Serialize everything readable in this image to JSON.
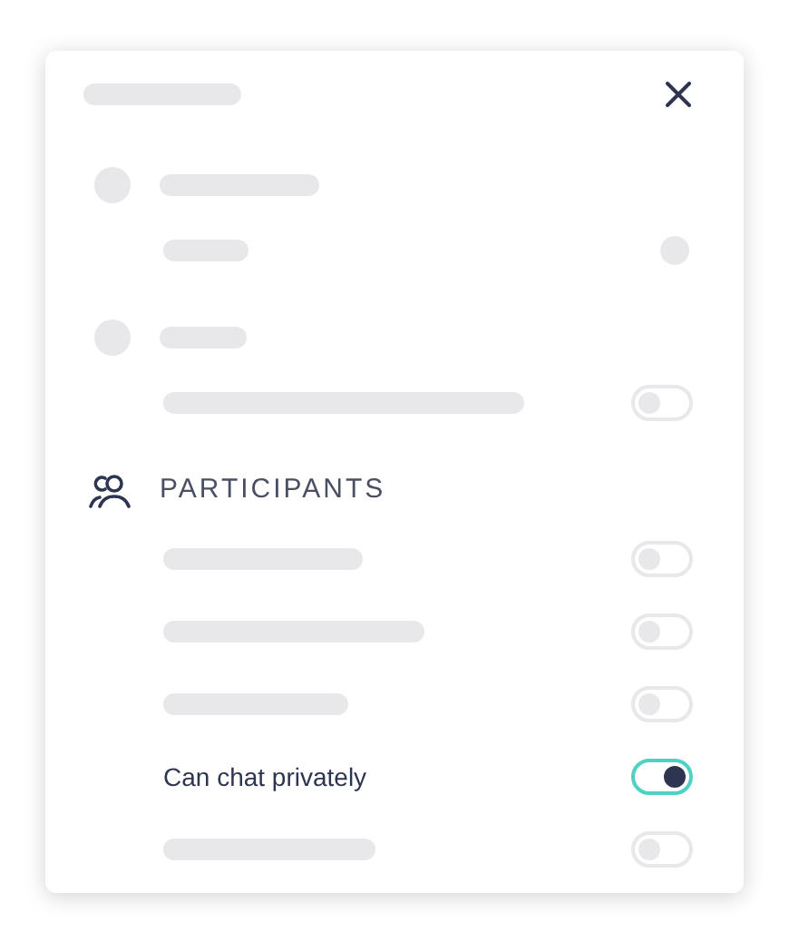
{
  "top_rows": [
    {
      "kind": "avatar-line"
    },
    {
      "kind": "dot-line"
    },
    {
      "kind": "avatar-line"
    },
    {
      "kind": "toggle-line",
      "on": false
    }
  ],
  "section": {
    "title": "PARTICIPANTS"
  },
  "participant_rows": [
    {
      "kind": "skeleton",
      "on": false
    },
    {
      "kind": "skeleton",
      "on": false
    },
    {
      "kind": "skeleton",
      "on": false
    },
    {
      "kind": "text",
      "label": "Can chat privately",
      "on": true
    },
    {
      "kind": "skeleton",
      "on": false
    }
  ]
}
